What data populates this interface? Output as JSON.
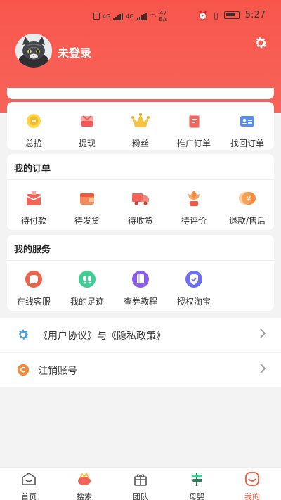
{
  "status_bar": {
    "network_1": "4G",
    "network_2": "4G",
    "speed_value": "47",
    "speed_unit": "B/s",
    "time": "5:27"
  },
  "profile": {
    "username": "未登录"
  },
  "shortcuts": [
    {
      "label": "总揽",
      "icon": "coin-icon"
    },
    {
      "label": "提现",
      "icon": "wallet-icon"
    },
    {
      "label": "粉丝",
      "icon": "crown-icon"
    },
    {
      "label": "推广订单",
      "icon": "doc-icon"
    },
    {
      "label": "找回订单",
      "icon": "id-card-icon"
    }
  ],
  "orders": {
    "title": "我的订单",
    "items": [
      {
        "label": "待付款",
        "icon": "box-icon"
      },
      {
        "label": "待发货",
        "icon": "wallet-icon"
      },
      {
        "label": "待收货",
        "icon": "truck-icon"
      },
      {
        "label": "待评价",
        "icon": "flower-icon"
      },
      {
        "label": "退款/售后",
        "icon": "refund-icon"
      }
    ]
  },
  "services": {
    "title": "我的服务",
    "items": [
      {
        "label": "在线客服",
        "icon": "chat-icon",
        "color": "#f0654a"
      },
      {
        "label": "我的足迹",
        "icon": "footprint-icon",
        "color": "#3ccf91"
      },
      {
        "label": "查券教程",
        "icon": "book-icon",
        "color": "#8b5cf0"
      },
      {
        "label": "授权淘宝",
        "icon": "shield-icon",
        "color": "#6b6ff5"
      }
    ]
  },
  "settings_list": [
    {
      "label": "《用户协议》与《隐私政策》",
      "icon": "gear-icon",
      "color": "#4a9fe8"
    },
    {
      "label": "注销账号",
      "icon": "cancel-icon",
      "color": "#f08a3c"
    }
  ],
  "tabbar": {
    "active_color": "#f0573a",
    "items": [
      {
        "label": "首页",
        "icon": "home-icon"
      },
      {
        "label": "搜索",
        "icon": "search-icon"
      },
      {
        "label": "团队",
        "icon": "gift-icon"
      },
      {
        "label": "母婴",
        "icon": "signpost-icon"
      },
      {
        "label": "我的",
        "icon": "smile-icon"
      }
    ]
  }
}
